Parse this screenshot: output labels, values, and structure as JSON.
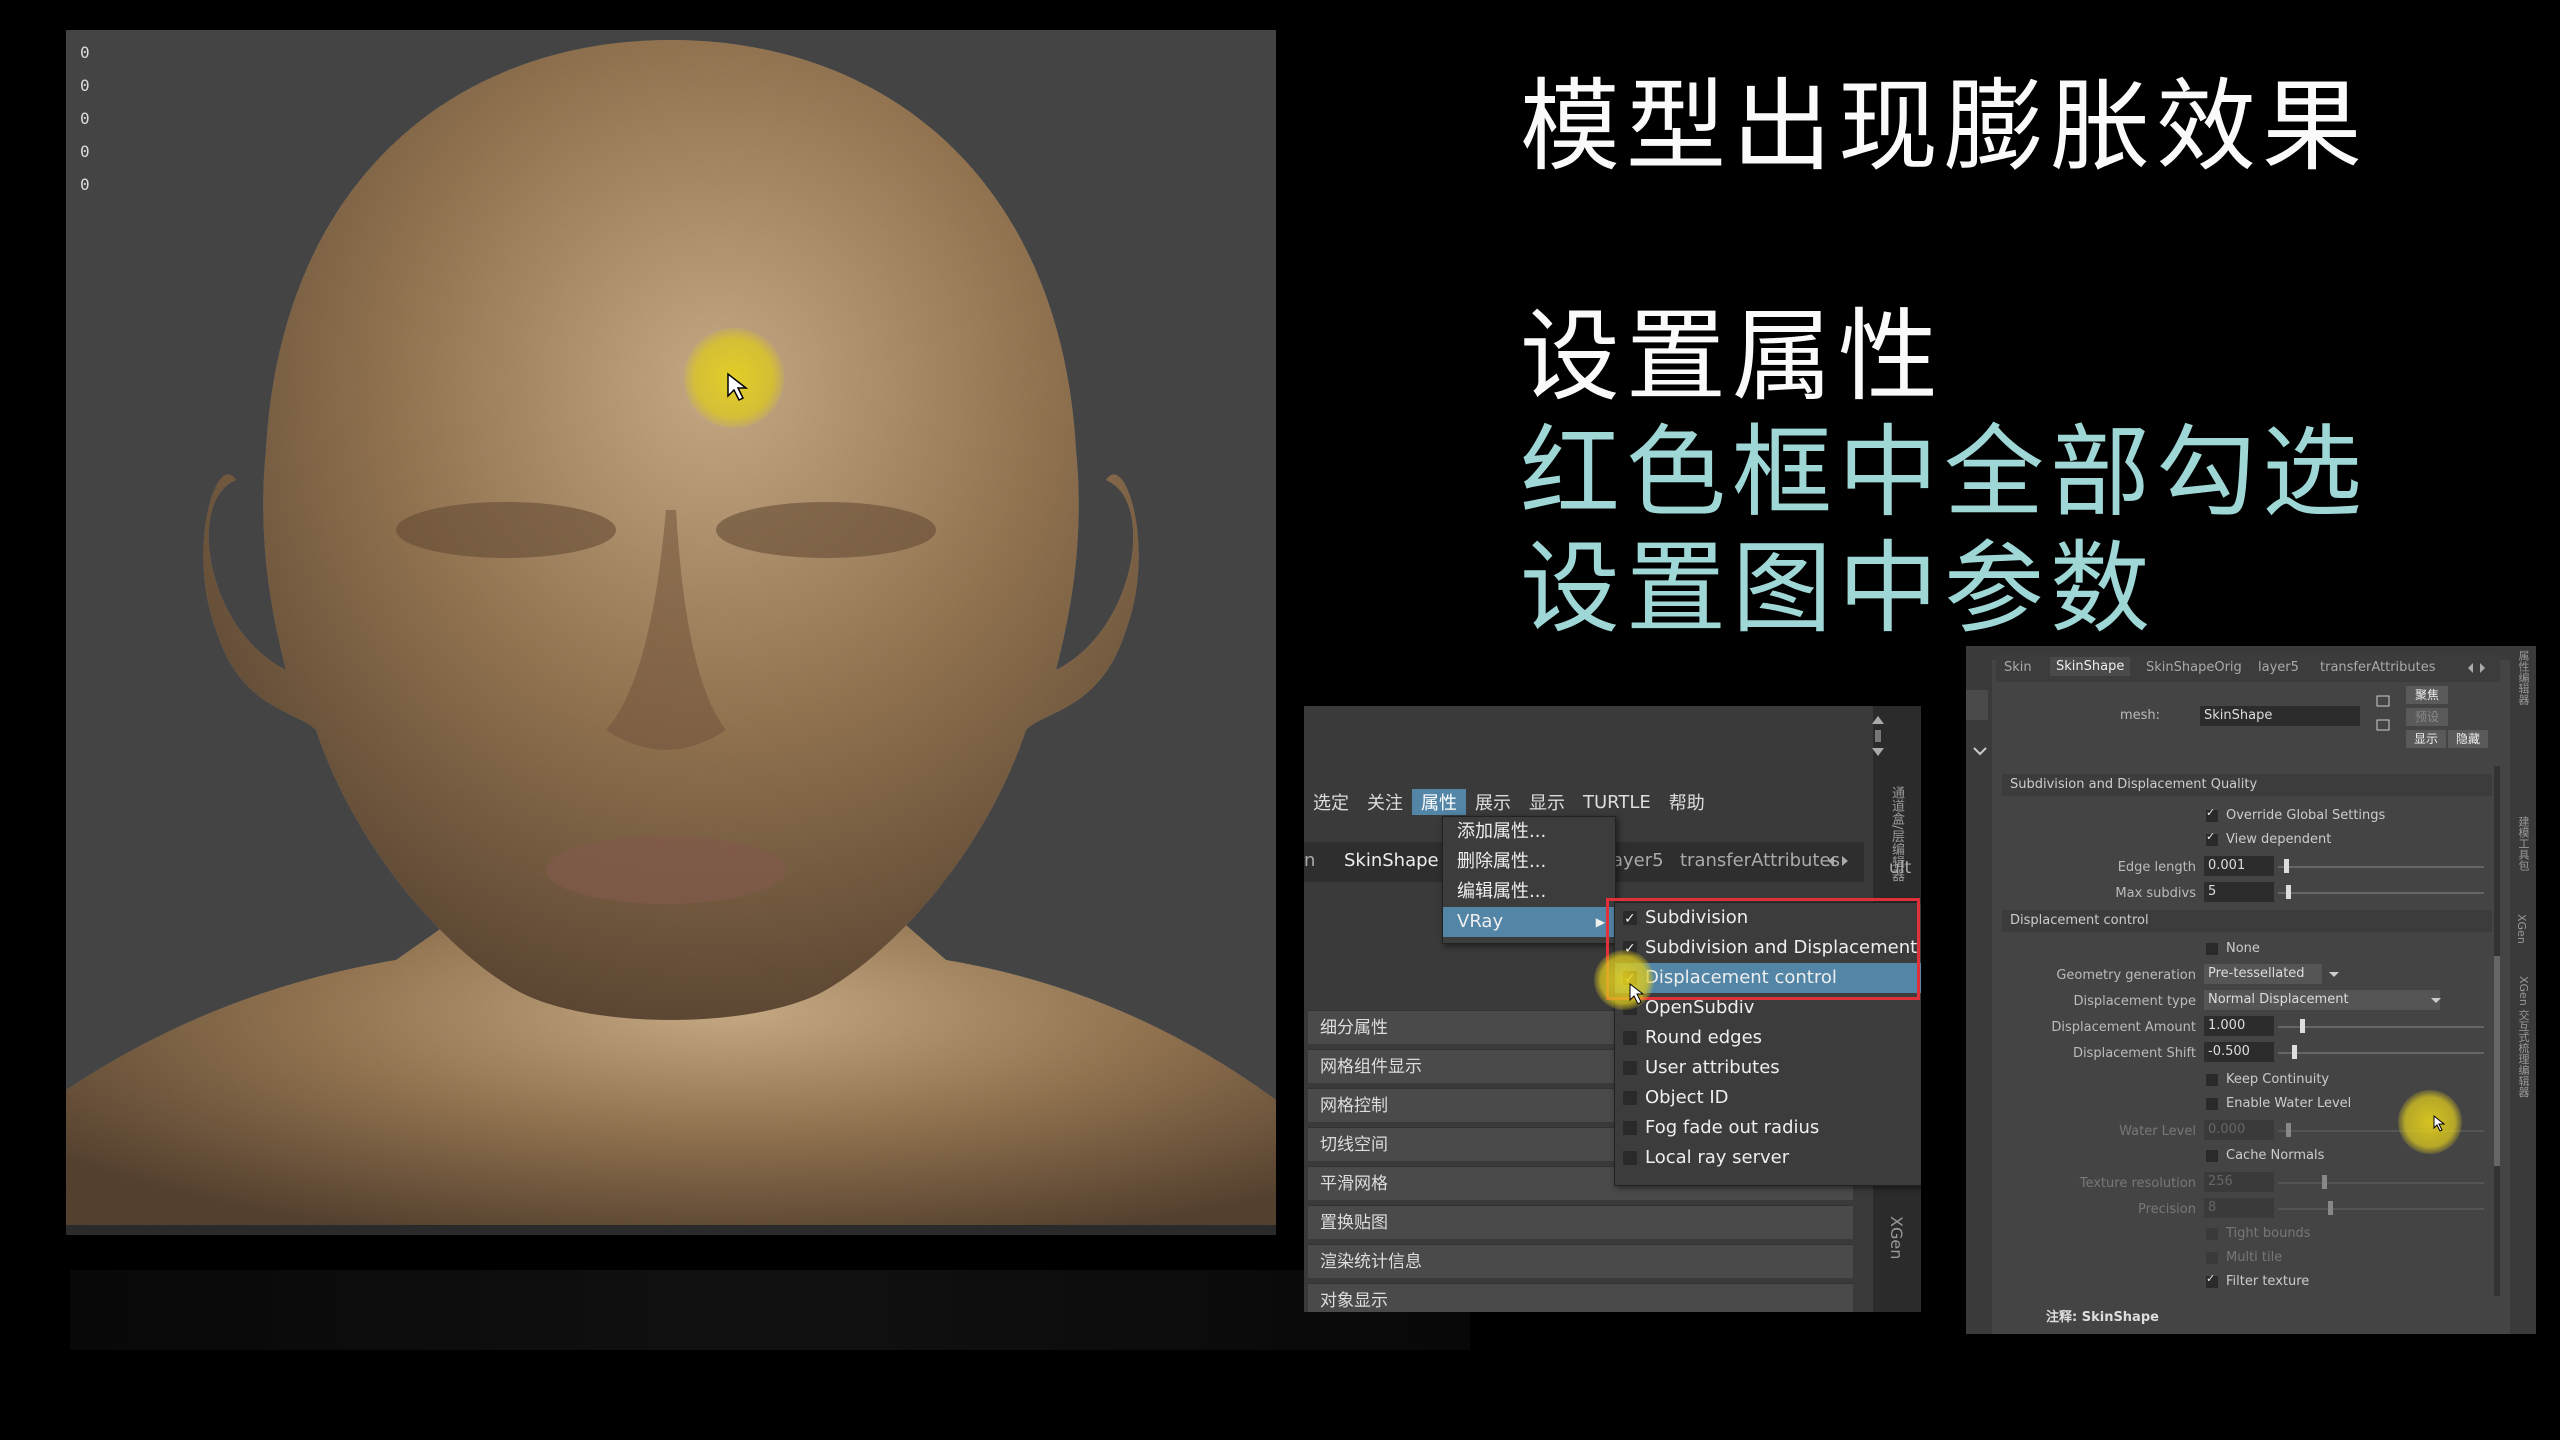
{
  "viewport": {
    "hud_values": [
      "0",
      "0",
      "0",
      "0",
      "0"
    ]
  },
  "slide": {
    "title": "模型出现膨胀效果",
    "line1": "设置属性",
    "line2": "红色框中全部勾选",
    "line3": "设置图中参数",
    "colors": {
      "white": "#fafafa",
      "teal": "#9fd7d7",
      "highlight": "#5285a6",
      "red_box": "#e0303a"
    }
  },
  "menu_panel": {
    "menubar": [
      "选定",
      "关注",
      "属性",
      "展示",
      "显示",
      "TURTLE",
      "帮助"
    ],
    "active_menu": "属性",
    "tabs": [
      "n",
      "SkinShape",
      "ayer5",
      "transferAttributes"
    ],
    "dropdown": [
      "添加属性...",
      "删除属性...",
      "编辑属性...",
      "VRay"
    ],
    "vray_submenu": [
      {
        "label": "Subdivision",
        "checked": true
      },
      {
        "label": "Subdivision and Displacement Quali",
        "checked": true
      },
      {
        "label": "Displacement control",
        "checked": true
      },
      {
        "label": "OpenSubdiv",
        "checked": false
      },
      {
        "label": "Round edges",
        "checked": false
      },
      {
        "label": "User attributes",
        "checked": false
      },
      {
        "label": "Object ID",
        "checked": false
      },
      {
        "label": "Fog fade out radius",
        "checked": false
      },
      {
        "label": "Local ray server",
        "checked": false
      }
    ],
    "sections": [
      "细分属性",
      "网格组件显示",
      "网格控制",
      "切线空间",
      "平滑网格",
      "置换贴图",
      "渲染统计信息",
      "对象显示"
    ],
    "side_label": "XGen",
    "side_tab_fragment": "ult",
    "side_vertical": "通道盒/层编辑器"
  },
  "attr_editor": {
    "tabs": [
      "Skin",
      "SkinShape",
      "SkinShapeOrig",
      "layer5",
      "transferAttributes"
    ],
    "selected_tab": "SkinShape",
    "mesh_label": "mesh:",
    "mesh_value": "SkinShape",
    "buttons": [
      "聚焦",
      "预设",
      "显示",
      "隐藏"
    ],
    "group_subdiv": "Subdivision and Displacement Quality",
    "override_global": {
      "label": "Override Global Settings",
      "checked": true
    },
    "view_dependent": {
      "label": "View dependent",
      "checked": true
    },
    "edge_length": {
      "label": "Edge length",
      "value": "0.001"
    },
    "max_subdivs": {
      "label": "Max subdivs",
      "value": "5"
    },
    "group_disp": "Displacement control",
    "none_cb": {
      "label": "None",
      "checked": false
    },
    "geometry_generation": {
      "label": "Geometry generation",
      "value": "Pre-tessellated"
    },
    "displacement_type": {
      "label": "Displacement type",
      "value": "Normal Displacement"
    },
    "displacement_amount": {
      "label": "Displacement Amount",
      "value": "1.000"
    },
    "displacement_shift": {
      "label": "Displacement Shift",
      "value": "-0.500"
    },
    "keep_continuity": {
      "label": "Keep Continuity",
      "checked": false
    },
    "enable_water": {
      "label": "Enable Water Level",
      "checked": false
    },
    "water_level": {
      "label": "Water Level",
      "value": "0.000"
    },
    "cache_normals": {
      "label": "Cache Normals",
      "checked": false
    },
    "texture_resolution": {
      "label": "Texture resolution",
      "value": "256"
    },
    "precision": {
      "label": "Precision",
      "value": "8"
    },
    "tight_bounds": {
      "label": "Tight bounds",
      "checked": false
    },
    "multi_tile": {
      "label": "Multi tile",
      "checked": false
    },
    "filter_texture": {
      "label": "Filter texture",
      "checked": true
    },
    "note": "注释:  SkinShape",
    "side_labels": [
      "XGen",
      "XGen 交互式梳理编辑器",
      "建模工具包",
      "属性编辑器"
    ]
  }
}
